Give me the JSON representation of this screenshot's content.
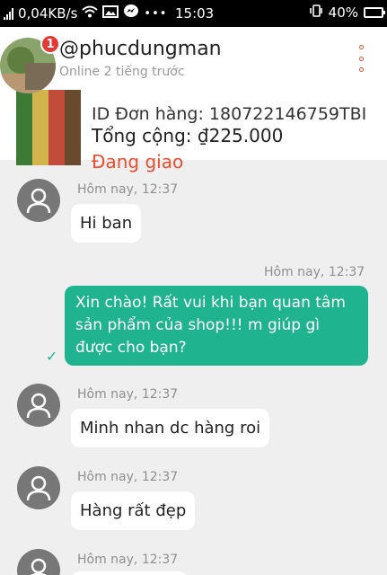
{
  "status_bar": {
    "speed": "0,04KB/s",
    "time": "15:03",
    "battery": "40%",
    "signal_icon": "signal-bars-icon",
    "wifi_icon": "wifi-icon",
    "image_icon": "image-icon",
    "messenger_icon": "messenger-icon",
    "vibrate_icon": "vibrate-icon",
    "overflow_dots": "•••"
  },
  "header": {
    "username": "@phucdungman",
    "presence": "Online 2 tiếng trước",
    "badge_count": "1",
    "more_icon": "vertical-dots-icon",
    "accent_color": "#ee4d2d"
  },
  "order": {
    "id_line": "ID Đơn hàng: 180722146759TBI",
    "total_line": "Tổng cộng: ₫225.000",
    "status": "Đang giao"
  },
  "messages": [
    {
      "direction": "in",
      "time": "Hôm nay, 12:37",
      "text": "Hi ban"
    },
    {
      "direction": "out",
      "time": "Hôm nay, 12:37",
      "text": "Xin chào! Rất vui khi bạn quan tâm sản phẩm của shop!!! m giúp gì được cho bạn?",
      "status_icon": "check-icon"
    },
    {
      "direction": "in",
      "time": "Hôm nay, 12:37",
      "text": "Minh nhan dc hàng roi"
    },
    {
      "direction": "in",
      "time": "Hôm nay, 12:37",
      "text": "Hàng rất đẹp"
    },
    {
      "direction": "in",
      "time": "Hôm nay, 12:37",
      "text": ""
    }
  ],
  "colors": {
    "outgoing_bubble": "#1fb48f",
    "background": "#efefef"
  }
}
